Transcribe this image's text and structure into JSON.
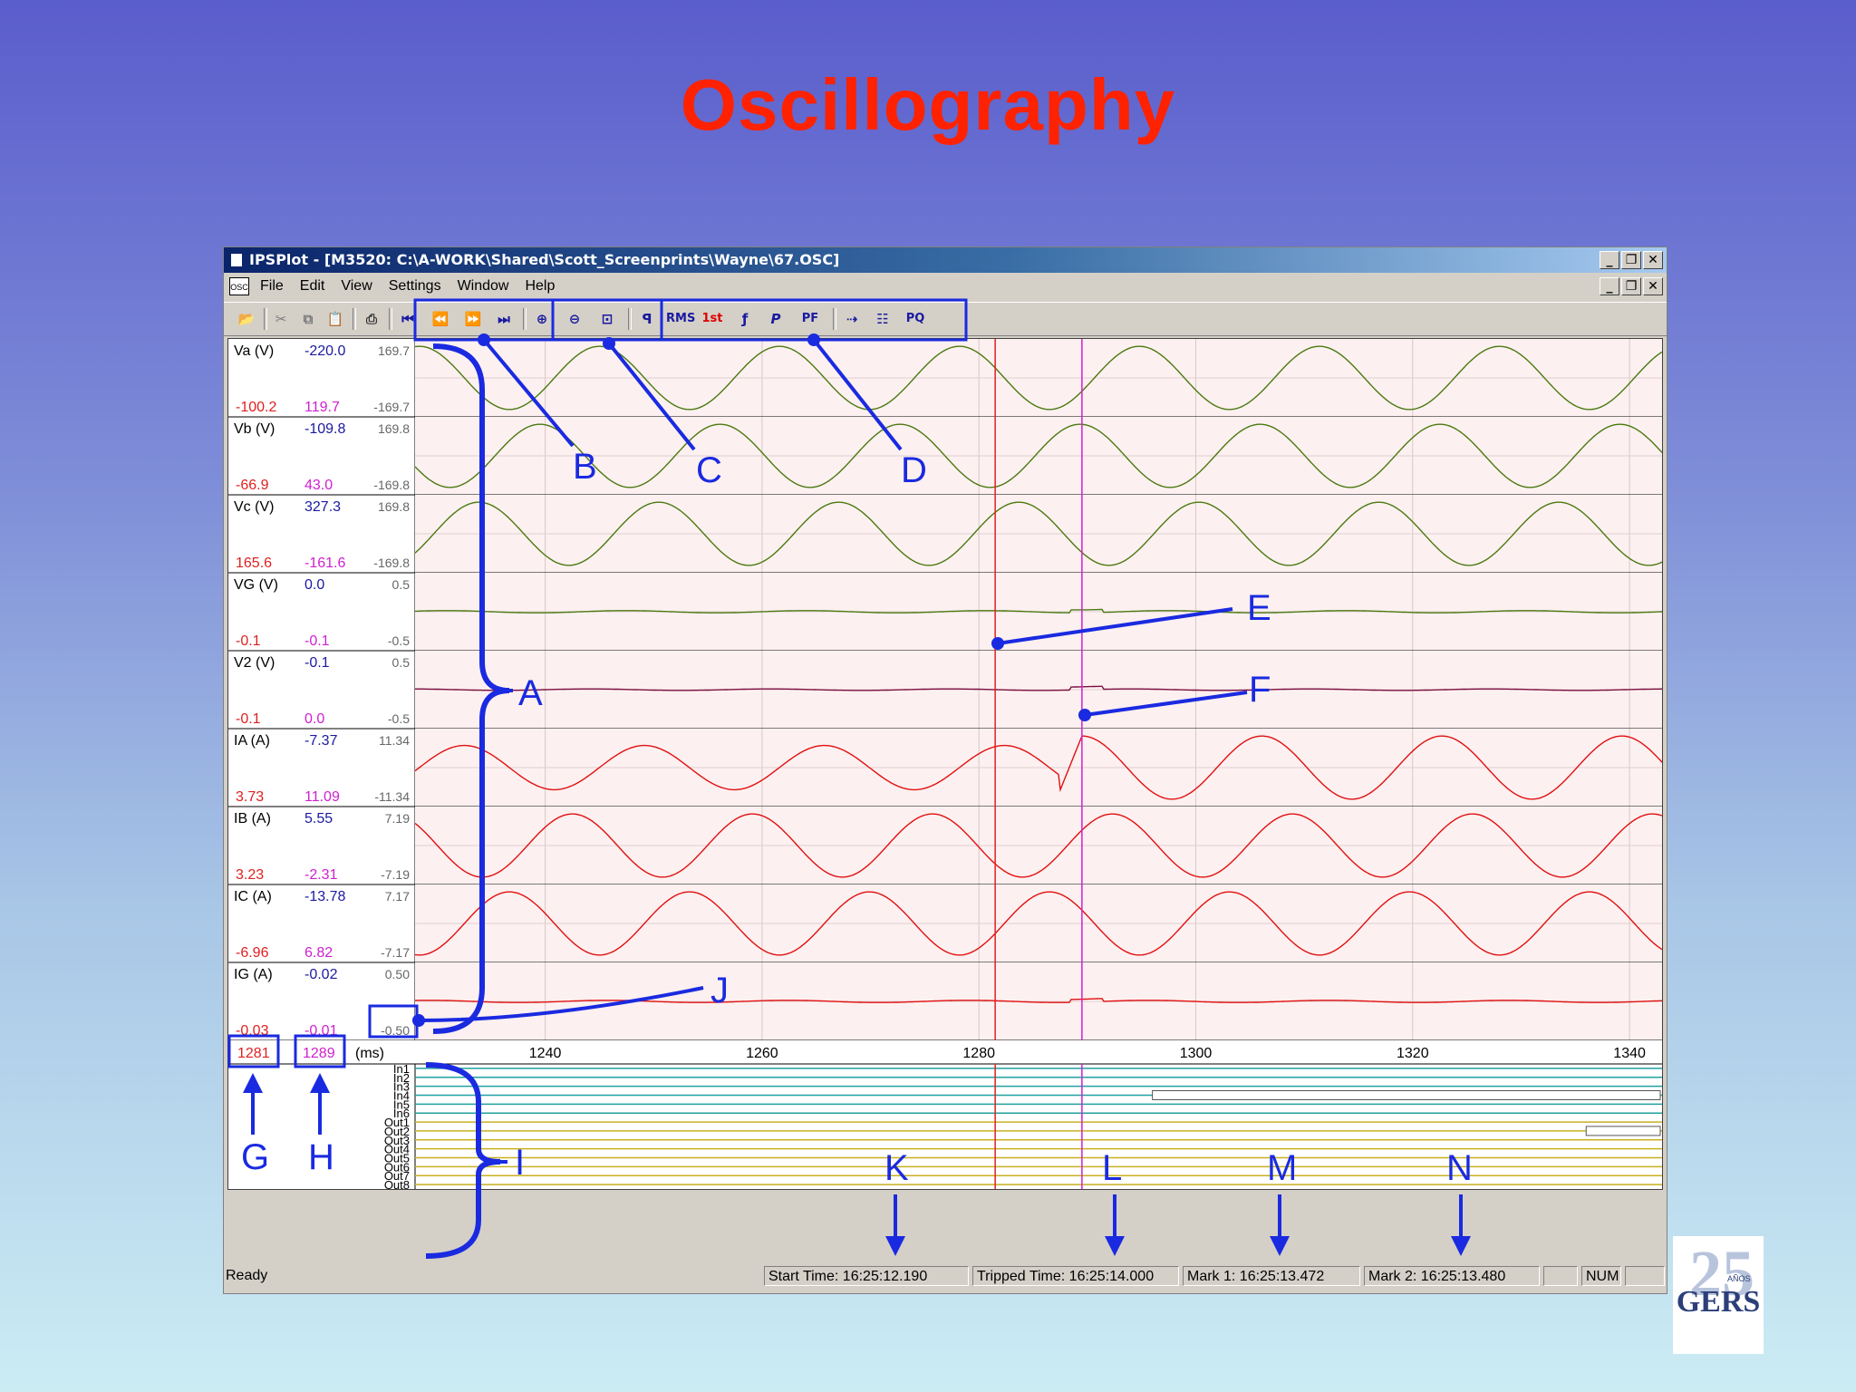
{
  "slide": {
    "title": "Oscillography"
  },
  "window": {
    "title": "IPSPlot - [M3520: C:\\A-WORK\\Shared\\Scott_Screenprints\\Wayne\\67.OSC]",
    "controls": {
      "minimize": "_",
      "restore": "❐",
      "close": "✕"
    }
  },
  "menu": {
    "app_icon": "OSC",
    "items": [
      "File",
      "Edit",
      "View",
      "Settings",
      "Window",
      "Help"
    ]
  },
  "toolbar": {
    "file_tools": [
      "open-icon",
      "cut-icon",
      "copy-icon",
      "paste-icon",
      "print-icon"
    ],
    "nav_tools": [
      "first-icon",
      "previous-icon",
      "next-icon",
      "last-icon"
    ],
    "zoom_tools": [
      "zoom-in-icon",
      "zoom-out-icon",
      "zoom-fit-icon"
    ],
    "analysis_tools": [
      "phasor",
      "RMS",
      "1st",
      "frequency",
      "P",
      "PF",
      "trace",
      "harmonics",
      "PQ"
    ],
    "labels": {
      "rms": "RMS",
      "first": "1st",
      "p": "P",
      "pf": "PF",
      "pq": "PQ"
    }
  },
  "channels": [
    {
      "name": "Va (V)",
      "cursor1": "-100.2",
      "cursor2": "119.7",
      "value": "-220.0",
      "max": "169.7",
      "min": "-169.7",
      "color": "#4a7a10",
      "amp": 0.85,
      "period": 16.6,
      "phase": 0.25,
      "kind": "sine"
    },
    {
      "name": "Vb (V)",
      "cursor1": "-66.9",
      "cursor2": "43.0",
      "value": "-109.8",
      "max": "169.8",
      "min": "-169.8",
      "color": "#4a7a10",
      "amp": 0.85,
      "period": 16.6,
      "phase": 0.58,
      "kind": "sine"
    },
    {
      "name": "Vc (V)",
      "cursor1": "165.6",
      "cursor2": "-161.6",
      "value": "327.3",
      "max": "169.8",
      "min": "-169.8",
      "color": "#4a7a10",
      "amp": 0.85,
      "period": 16.6,
      "phase": 0.92,
      "kind": "sine"
    },
    {
      "name": "VG (V)",
      "cursor1": "-0.1",
      "cursor2": "-0.1",
      "value": "0.0",
      "max": "0.5",
      "min": "-0.5",
      "color": "#4a7a10",
      "amp": 0.03,
      "period": 16.6,
      "phase": 0.1,
      "kind": "flat"
    },
    {
      "name": "V2 (V)",
      "cursor1": "-0.1",
      "cursor2": "0.0",
      "value": "-0.1",
      "max": "0.5",
      "min": "-0.5",
      "color": "#7a1040",
      "amp": 0.02,
      "period": 16.6,
      "phase": 0.3,
      "kind": "flat"
    },
    {
      "name": "IA (A)",
      "cursor1": "3.73",
      "cursor2": "11.09",
      "value": "-7.37",
      "max": "11.34",
      "min": "-11.34",
      "color": "#e01010",
      "amp": 0.85,
      "period": 16.6,
      "phase": 0.0,
      "kind": "fault"
    },
    {
      "name": "IB (A)",
      "cursor1": "3.23",
      "cursor2": "-2.31",
      "value": "5.55",
      "max": "7.19",
      "min": "-7.19",
      "color": "#e01010",
      "amp": 0.85,
      "period": 16.6,
      "phase": 0.4,
      "kind": "sine"
    },
    {
      "name": "IC (A)",
      "cursor1": "-6.96",
      "cursor2": "6.82",
      "value": "-13.78",
      "max": "7.17",
      "min": "-7.17",
      "color": "#e01010",
      "amp": 0.85,
      "period": 16.6,
      "phase": 0.75,
      "kind": "sine"
    },
    {
      "name": "IG (A)",
      "cursor1": "-0.03",
      "cursor2": "-0.01",
      "value": "-0.02",
      "max": "0.50",
      "min": "-0.50",
      "color": "#e01010",
      "amp": 0.03,
      "period": 16.6,
      "phase": 0.2,
      "kind": "flat"
    }
  ],
  "time_axis": {
    "cursor1": "1281",
    "cursor2": "1289",
    "unit": "(ms)",
    "ticks": [
      "1240",
      "1260",
      "1280",
      "1300",
      "1320",
      "1340"
    ],
    "tick_values": [
      1240,
      1260,
      1280,
      1300,
      1320,
      1340
    ],
    "range": [
      1228,
      1343
    ],
    "cursor1_value": 1281.5,
    "cursor2_value": 1289.5
  },
  "digital_channels": [
    {
      "name": "In1",
      "color": "#20a0a0"
    },
    {
      "name": "In2",
      "color": "#20a0a0"
    },
    {
      "name": "In3",
      "color": "#20a0a0"
    },
    {
      "name": "In4",
      "color": "#20a0a0",
      "high_from": 1296
    },
    {
      "name": "In5",
      "color": "#20a0a0"
    },
    {
      "name": "In6",
      "color": "#20a0a0"
    },
    {
      "name": "Out1",
      "color": "#c8b020"
    },
    {
      "name": "Out2",
      "color": "#c8b020",
      "high_from": 1336
    },
    {
      "name": "Out3",
      "color": "#c8b020"
    },
    {
      "name": "Out4",
      "color": "#c8b020"
    },
    {
      "name": "Out5",
      "color": "#c8b020"
    },
    {
      "name": "Out6",
      "color": "#c8b020"
    },
    {
      "name": "Out7",
      "color": "#c8b020"
    },
    {
      "name": "Out8",
      "color": "#c8b020"
    }
  ],
  "status": {
    "ready": "Ready",
    "start_time": "Start Time:  16:25:12.190",
    "tripped_time": "Tripped Time:  16:25:14.000",
    "mark1": "Mark 1:  16:25:13.472",
    "mark2": "Mark 2:  16:25:13.480",
    "num": "NUM"
  },
  "callouts": [
    "A",
    "B",
    "C",
    "D",
    "E",
    "F",
    "G",
    "H",
    "I",
    "J",
    "K",
    "L",
    "M",
    "N"
  ],
  "colors": {
    "callout": "#1a2ae0",
    "cursor1": "#e02020",
    "cursor2": "#d020d0",
    "title": "#ff2200"
  },
  "logo": {
    "text": "GERS",
    "number": "25",
    "sub": "AÑOS"
  }
}
